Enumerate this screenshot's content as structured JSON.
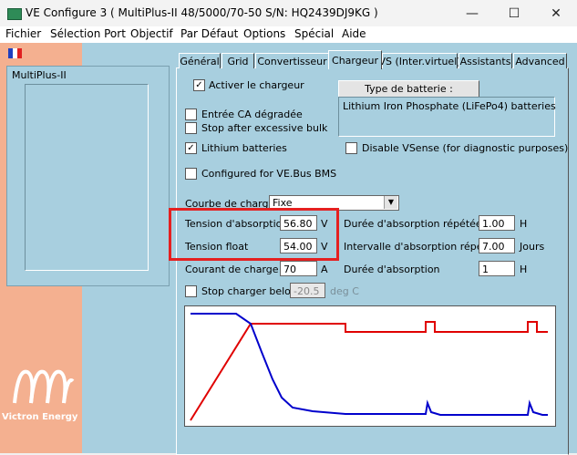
{
  "window": {
    "title": "VE Configure 3    ( MultiPlus-II 48/5000/70-50 S/N: HQ2439DJ9KG )",
    "controls": [
      "—",
      "☐",
      "✕"
    ]
  },
  "menu": [
    "Fichier",
    "Sélection Port",
    "Objectif",
    "Par Défaut",
    "Options",
    "Spécial",
    "Aide"
  ],
  "sidebar": {
    "device": "MultiPlus-II",
    "logo_text": "Victron Energy"
  },
  "tabs": [
    "Général",
    "Grid",
    "Convertisseur",
    "Chargeur",
    "VS (Inter.virtuel)",
    "Assistants",
    "Advanced"
  ],
  "active_tab": "Chargeur",
  "charger": {
    "enable_charger": {
      "label": "Activer le chargeur",
      "checked": true
    },
    "weak_ac": {
      "label": "Entrée CA dégradée",
      "checked": false
    },
    "stop_bulk": {
      "label": "Stop after excessive bulk",
      "checked": false
    },
    "lithium": {
      "label": "Lithium batteries",
      "checked": true
    },
    "disable_vsense": {
      "label": "Disable VSense (for diagnostic purposes)",
      "checked": false
    },
    "vebus_bms": {
      "label": "Configured for VE.Bus BMS",
      "checked": false
    },
    "battery_type_button": "Type de batterie :",
    "battery_type_value": "Lithium Iron Phosphate (LiFePo4) batteries",
    "curve_label": "Courbe de charge",
    "curve_value": "Fixe",
    "absorption_voltage": {
      "label": "Tension d'absorption",
      "value": "56.80",
      "unit": "V"
    },
    "float_voltage": {
      "label": "Tension float",
      "value": "54.00",
      "unit": "V"
    },
    "charge_current": {
      "label": "Courant de charge",
      "value": "70",
      "unit": "A"
    },
    "repeated_absorption_time": {
      "label": "Durée d'absorption répétée",
      "value": "1.00",
      "unit": "H"
    },
    "repeated_absorption_interval": {
      "label": "Intervalle d'absorption répétée",
      "value": "7.00",
      "unit": "Jours"
    },
    "absorption_time": {
      "label": "Durée d'absorption",
      "value": "1",
      "unit": "H"
    },
    "stop_below": {
      "label": "Stop charger below",
      "value": "-20.5",
      "unit": "deg C",
      "checked": false
    }
  },
  "colors": {
    "panel_bg": "#a8cfdf",
    "sidebar_bg": "#f4b090",
    "highlight": "#e52020",
    "voltage_line": "#e00000",
    "current_line": "#0000cc"
  },
  "icons": {
    "flag": "french-flag-icon",
    "logo": "victron-logo-icon",
    "app": "ve-configure-app-icon"
  }
}
